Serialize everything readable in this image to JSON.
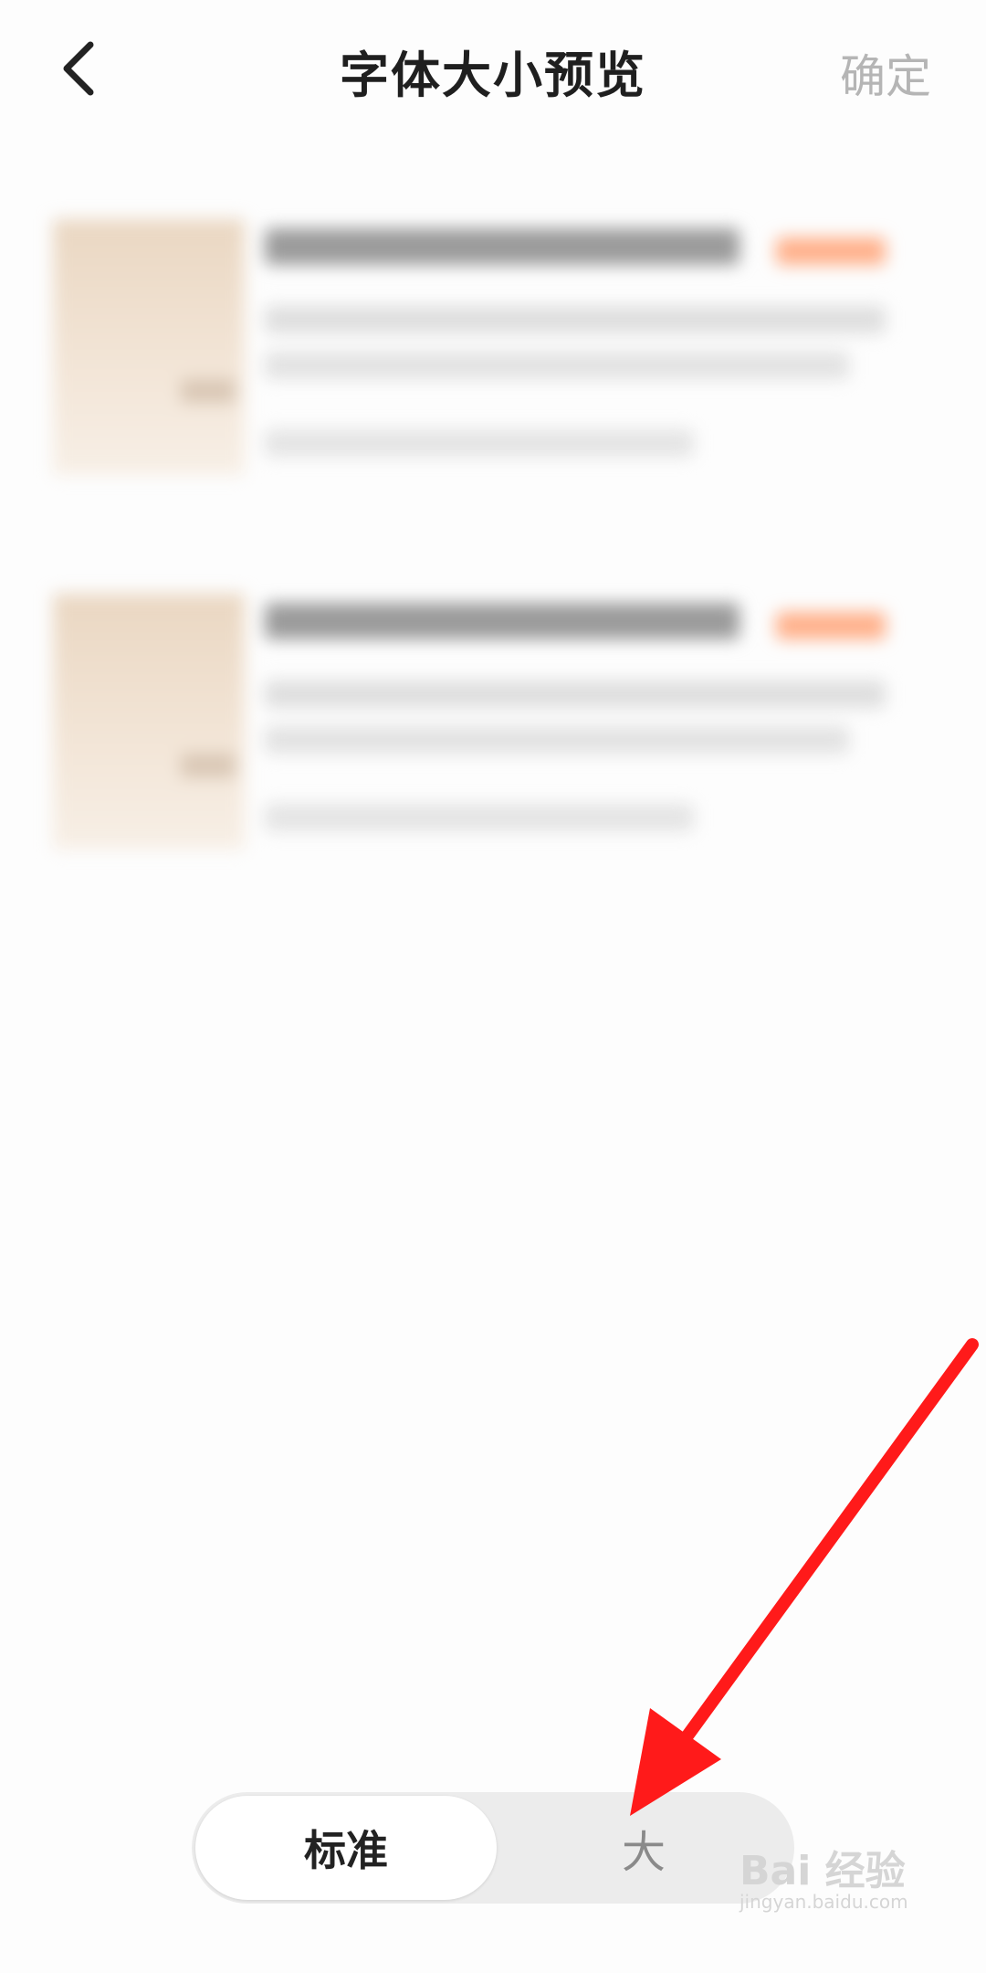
{
  "header": {
    "title": "字体大小预览",
    "confirm_label": "确定",
    "back_icon": "chevron-left-icon"
  },
  "font_size_options": {
    "standard_label": "标准",
    "large_label": "大",
    "selected": "标准"
  },
  "annotation": {
    "arrow_color": "#ff1a1a"
  },
  "watermark": {
    "main": "Bai 经验",
    "sub": "jingyan.baidu.com"
  },
  "colors": {
    "confirm_text": "#b5b5b5",
    "badge_orange": "#ffb08a"
  }
}
